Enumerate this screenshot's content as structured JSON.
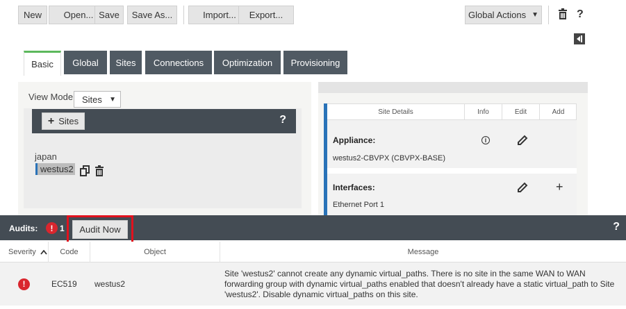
{
  "toolbar": {
    "new_label": "New",
    "open_label": "Open...",
    "save_label": "Save",
    "save_as_label": "Save As...",
    "import_label": "Import...",
    "export_label": "Export...",
    "global_actions_label": "Global Actions",
    "help_label": "?"
  },
  "tabs": [
    {
      "label": "Basic",
      "active": true
    },
    {
      "label": "Global",
      "active": false
    },
    {
      "label": "Sites",
      "active": false
    },
    {
      "label": "Connections",
      "active": false
    },
    {
      "label": "Optimization",
      "active": false
    },
    {
      "label": "Provisioning",
      "active": false
    }
  ],
  "left_panel": {
    "view_mode_label": "View Mode:",
    "view_mode_value": "Sites",
    "sites_button_label": "Sites",
    "help_label": "?",
    "tree": [
      "japan",
      "westus2"
    ]
  },
  "site_details": {
    "headers": [
      "Site Details",
      "Info",
      "Edit",
      "Add"
    ],
    "rows": [
      {
        "title": "Appliance:",
        "value": "westus2-CBVPX (CBVPX-BASE)"
      },
      {
        "title": "Interfaces:",
        "value": "Ethernet Port 1"
      }
    ]
  },
  "audits": {
    "label": "Audits:",
    "badge": "!",
    "count": "1",
    "audit_now_label": "Audit Now",
    "help_label": "?",
    "columns": [
      "Severity",
      "Code",
      "Object",
      "Message"
    ],
    "rows": [
      {
        "severity_icon": "!",
        "code": "EC519",
        "object": "westus2",
        "message": "Site 'westus2' cannot create any dynamic virtual_paths. There is no site in the same WAN to WAN forwarding group with dynamic virtual_paths enabled that doesn't already have a static virtual_path to Site 'westus2'. Disable dynamic virtual_paths on this site."
      }
    ]
  },
  "colors": {
    "tab_bg": "#505a63",
    "active_tab_accent": "#5cb85c",
    "bar_bg": "#444c54",
    "error_red": "#d9262e",
    "highlight_red": "#e1121e",
    "selection_blue": "#2a73b8"
  }
}
